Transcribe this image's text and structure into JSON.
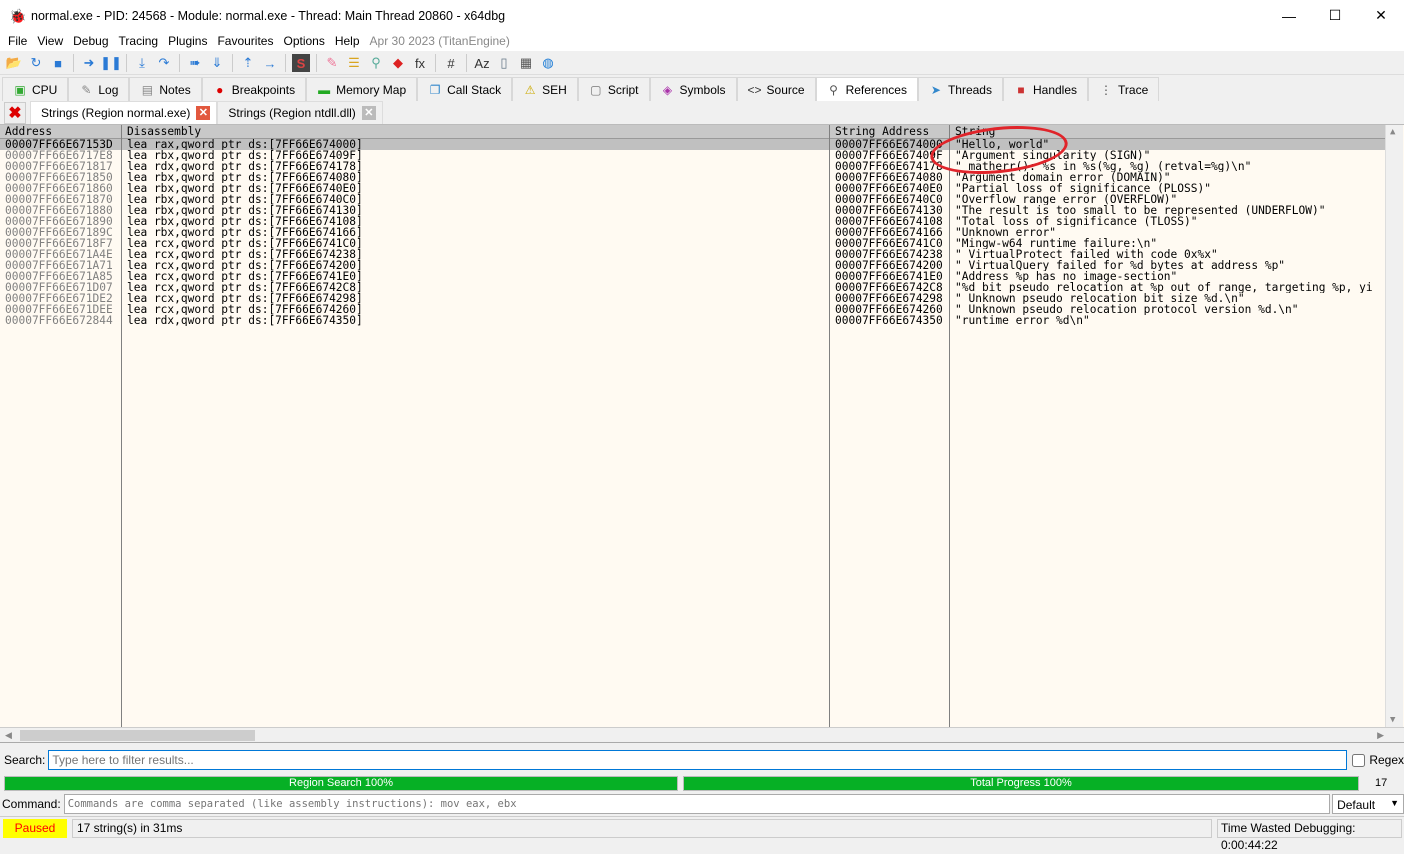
{
  "window": {
    "title": "normal.exe - PID: 24568 - Module: normal.exe - Thread: Main Thread 20860 - x64dbg",
    "minimize": "—",
    "maximize": "☐",
    "close": "✕"
  },
  "menu": [
    "File",
    "View",
    "Debug",
    "Tracing",
    "Plugins",
    "Favourites",
    "Options",
    "Help"
  ],
  "menu_version": "Apr 30 2023 (TitanEngine)",
  "toolbar": [
    "open-icon",
    "restart-icon",
    "stop-icon",
    "run-icon",
    "pause-icon",
    "step-into-icon",
    "step-over-icon",
    "trace-into-icon",
    "trace-over-icon",
    "execute-till-return-icon",
    "run-to-user-code-icon",
    "scylla-icon",
    "patch-icon",
    "comment-icon",
    "label-icon",
    "bookmark-icon",
    "function-icon",
    "hash-icon",
    "font-icon",
    "device-icon",
    "calculator-icon",
    "globe-icon"
  ],
  "tabs": [
    {
      "label": "CPU",
      "icon": "cpu-icon"
    },
    {
      "label": "Log",
      "icon": "log-icon"
    },
    {
      "label": "Notes",
      "icon": "notes-icon"
    },
    {
      "label": "Breakpoints",
      "icon": "breakpoint-icon"
    },
    {
      "label": "Memory Map",
      "icon": "memory-icon"
    },
    {
      "label": "Call Stack",
      "icon": "callstack-icon"
    },
    {
      "label": "SEH",
      "icon": "seh-icon"
    },
    {
      "label": "Script",
      "icon": "script-icon"
    },
    {
      "label": "Symbols",
      "icon": "symbols-icon"
    },
    {
      "label": "Source",
      "icon": "source-icon"
    },
    {
      "label": "References",
      "icon": "search-icon"
    },
    {
      "label": "Threads",
      "icon": "threads-icon"
    },
    {
      "label": "Handles",
      "icon": "handles-icon"
    },
    {
      "label": "Trace",
      "icon": "trace-icon"
    }
  ],
  "subtabs": [
    "Strings (Region normal.exe)",
    "Strings (Region ntdll.dll)"
  ],
  "columns": {
    "address": "Address",
    "disassembly": "Disassembly",
    "string_address": "String Address",
    "string": "String"
  },
  "rows": [
    {
      "address": "00007FF66E67153D",
      "disassembly": "lea rax,qword ptr ds:[7FF66E674000]",
      "string_address": "00007FF66E674000",
      "string": "\"Hello, world\""
    },
    {
      "address": "00007FF66E6717E8",
      "disassembly": "lea rbx,qword ptr ds:[7FF66E67409F]",
      "string_address": "00007FF66E67409F",
      "string": "\"Argument singularity (SIGN)\""
    },
    {
      "address": "00007FF66E671817",
      "disassembly": "lea rdx,qword ptr ds:[7FF66E674178]",
      "string_address": "00007FF66E674178",
      "string": "\"_matherr(): %s in %s(%g, %g)  (retval=%g)\\n\""
    },
    {
      "address": "00007FF66E671850",
      "disassembly": "lea rbx,qword ptr ds:[7FF66E674080]",
      "string_address": "00007FF66E674080",
      "string": "\"Argument domain error (DOMAIN)\""
    },
    {
      "address": "00007FF66E671860",
      "disassembly": "lea rbx,qword ptr ds:[7FF66E6740E0]",
      "string_address": "00007FF66E6740E0",
      "string": "\"Partial loss of significance (PLOSS)\""
    },
    {
      "address": "00007FF66E671870",
      "disassembly": "lea rbx,qword ptr ds:[7FF66E6740C0]",
      "string_address": "00007FF66E6740C0",
      "string": "\"Overflow range error (OVERFLOW)\""
    },
    {
      "address": "00007FF66E671880",
      "disassembly": "lea rbx,qword ptr ds:[7FF66E674130]",
      "string_address": "00007FF66E674130",
      "string": "\"The result is too small to be represented (UNDERFLOW)\""
    },
    {
      "address": "00007FF66E671890",
      "disassembly": "lea rbx,qword ptr ds:[7FF66E674108]",
      "string_address": "00007FF66E674108",
      "string": "\"Total loss of significance (TLOSS)\""
    },
    {
      "address": "00007FF66E67189C",
      "disassembly": "lea rbx,qword ptr ds:[7FF66E674166]",
      "string_address": "00007FF66E674166",
      "string": "\"Unknown error\""
    },
    {
      "address": "00007FF66E6718F7",
      "disassembly": "lea rcx,qword ptr ds:[7FF66E6741C0]",
      "string_address": "00007FF66E6741C0",
      "string": "\"Mingw-w64 runtime failure:\\n\""
    },
    {
      "address": "00007FF66E671A4E",
      "disassembly": "lea rcx,qword ptr ds:[7FF66E674238]",
      "string_address": "00007FF66E674238",
      "string": "\"  VirtualProtect failed with code 0x%x\""
    },
    {
      "address": "00007FF66E671A71",
      "disassembly": "lea rcx,qword ptr ds:[7FF66E674200]",
      "string_address": "00007FF66E674200",
      "string": "\"  VirtualQuery failed for %d bytes at address %p\""
    },
    {
      "address": "00007FF66E671A85",
      "disassembly": "lea rcx,qword ptr ds:[7FF66E6741E0]",
      "string_address": "00007FF66E6741E0",
      "string": "\"Address %p has no image-section\""
    },
    {
      "address": "00007FF66E671D07",
      "disassembly": "lea rcx,qword ptr ds:[7FF66E6742C8]",
      "string_address": "00007FF66E6742C8",
      "string": "\"%d bit pseudo relocation at %p out of range, targeting %p, yi"
    },
    {
      "address": "00007FF66E671DE2",
      "disassembly": "lea rcx,qword ptr ds:[7FF66E674298]",
      "string_address": "00007FF66E674298",
      "string": "\"  Unknown pseudo relocation bit size %d.\\n\""
    },
    {
      "address": "00007FF66E671DEE",
      "disassembly": "lea rcx,qword ptr ds:[7FF66E674260]",
      "string_address": "00007FF66E674260",
      "string": "\"  Unknown pseudo relocation protocol version %d.\\n\""
    },
    {
      "address": "00007FF66E672844",
      "disassembly": "lea rdx,qword ptr ds:[7FF66E674350]",
      "string_address": "00007FF66E674350",
      "string": "\"runtime error %d\\n\""
    }
  ],
  "search": {
    "label": "Search:",
    "placeholder": "Type here to filter results...",
    "regex_label": "Regex"
  },
  "progress": {
    "region_label": "Region Search 100%",
    "region_value": 100,
    "total_label": "Total Progress 100%",
    "total_value": 100,
    "count": "17"
  },
  "command": {
    "label": "Command:",
    "placeholder": "Commands are comma separated (like assembly instructions): mov eax, ebx",
    "mode": "Default"
  },
  "status": {
    "state": "Paused",
    "message": "17 string(s) in 31ms",
    "time_wasted": "Time Wasted Debugging: 0:00:44:22"
  },
  "colors": {
    "progress": "#06b025",
    "paused_bg": "#ffff00",
    "paused_fg": "#ff0000",
    "row_bg": "#fffaf2",
    "selected": "#c0c0c0",
    "annotation": "#e0242a"
  }
}
